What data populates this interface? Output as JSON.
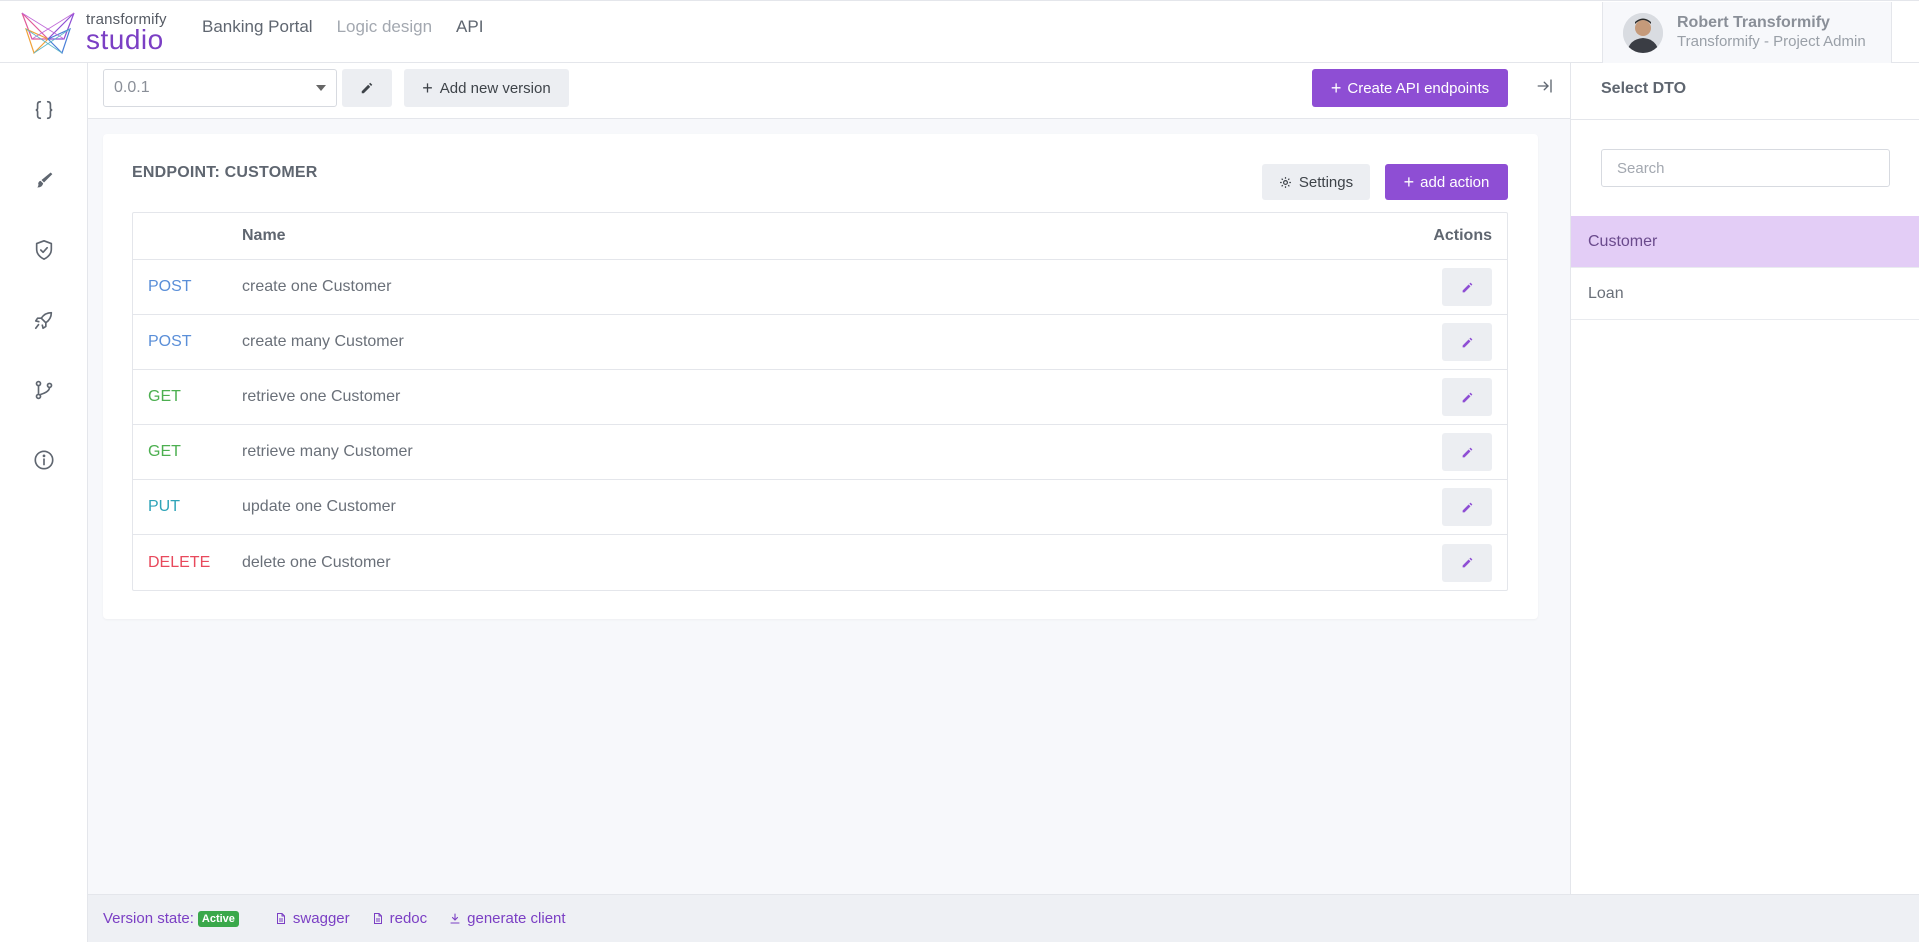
{
  "brand": {
    "small": "transformify",
    "big": "studio"
  },
  "nav": [
    {
      "label": "Banking Portal",
      "muted": false
    },
    {
      "label": "Logic design",
      "muted": true
    },
    {
      "label": "API",
      "muted": false
    }
  ],
  "user": {
    "name": "Robert Transformify",
    "role": "Transformify - Project Admin"
  },
  "toolbar": {
    "version": "0.0.1",
    "add_version_label": "Add new version",
    "create_endpoints_label": "Create API endpoints"
  },
  "endpoint": {
    "title": "ENDPOINT: CUSTOMER",
    "settings_label": "Settings",
    "add_action_label": "add action",
    "columns": {
      "name": "Name",
      "actions": "Actions"
    },
    "rows": [
      {
        "method": "POST",
        "color": "#5b8fd8",
        "name": "create one Customer"
      },
      {
        "method": "POST",
        "color": "#5b8fd8",
        "name": "create many Customer"
      },
      {
        "method": "GET",
        "color": "#4caf50",
        "name": "retrieve one Customer"
      },
      {
        "method": "GET",
        "color": "#4caf50",
        "name": "retrieve many Customer"
      },
      {
        "method": "PUT",
        "color": "#2fa4b8",
        "name": "update one Customer"
      },
      {
        "method": "DELETE",
        "color": "#e8495c",
        "name": "delete one Customer"
      }
    ]
  },
  "dto": {
    "title": "Select DTO",
    "search_placeholder": "Search",
    "items": [
      {
        "label": "Customer",
        "active": true
      },
      {
        "label": "Loan",
        "active": false
      }
    ]
  },
  "footer": {
    "version_state_label": "Version state:",
    "badge": "Active",
    "swagger": "swagger",
    "redoc": "redoc",
    "generate_client": "generate client"
  },
  "colors": {
    "accent": "#8e4ed4",
    "active_item": "#e3cdf6",
    "badge": "#3aa84a"
  }
}
